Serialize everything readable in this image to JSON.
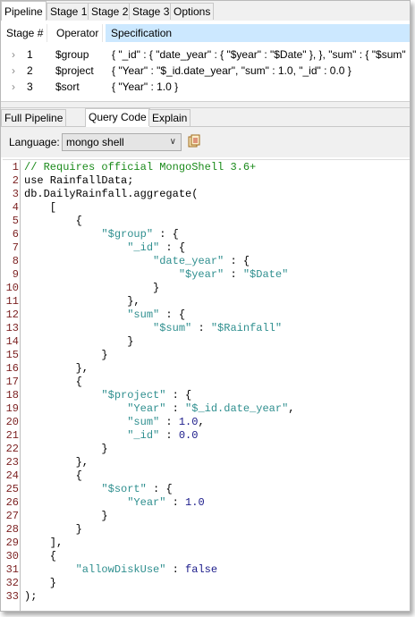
{
  "top_tabs": [
    "Pipeline",
    "Stage 1",
    "Stage 2",
    "Stage 3",
    "Options"
  ],
  "table": {
    "headers": [
      "Stage #",
      "Operator",
      "Specification"
    ],
    "rows": [
      {
        "num": "1",
        "op": "$group",
        "spec": "{ \"_id\" : { \"date_year\" : { \"$year\" : \"$Date\" }, }, \"sum\" : { \"$sum\" :"
      },
      {
        "num": "2",
        "op": "$project",
        "spec": "{ \"Year\" : \"$_id.date_year\", \"sum\" : 1.0, \"_id\" : 0.0 }"
      },
      {
        "num": "3",
        "op": "$sort",
        "spec": "{ \"Year\" : 1.0 }"
      }
    ]
  },
  "bottom_tabs": [
    "Full Pipeline",
    "Query Code",
    "Explain"
  ],
  "language": {
    "label": "Language:",
    "value": "mongo shell"
  },
  "code": {
    "numbers": [
      "1",
      "2",
      "3",
      "4",
      "5",
      "6",
      "7",
      "8",
      "9",
      "10",
      "11",
      "12",
      "13",
      "14",
      "15",
      "16",
      "17",
      "18",
      "19",
      "20",
      "21",
      "22",
      "23",
      "24",
      "25",
      "26",
      "27",
      "28",
      "29",
      "30",
      "31",
      "32",
      "33"
    ],
    "lines": [
      [
        {
          "t": "// Requires official MongoShell 3.6+",
          "c": "c"
        }
      ],
      [
        {
          "t": "use RainfallData;",
          "c": "k"
        }
      ],
      [
        {
          "t": "db.DailyRainfall.aggregate(",
          "c": "k"
        }
      ],
      [
        {
          "t": "    [",
          "c": "k"
        }
      ],
      [
        {
          "t": "        {",
          "c": "k"
        }
      ],
      [
        {
          "t": "            ",
          "c": "k"
        },
        {
          "t": "\"$group\"",
          "c": "s"
        },
        {
          "t": " : {",
          "c": "k"
        }
      ],
      [
        {
          "t": "                ",
          "c": "k"
        },
        {
          "t": "\"_id\"",
          "c": "s"
        },
        {
          "t": " : {",
          "c": "k"
        }
      ],
      [
        {
          "t": "                    ",
          "c": "k"
        },
        {
          "t": "\"date_year\"",
          "c": "s"
        },
        {
          "t": " : {",
          "c": "k"
        }
      ],
      [
        {
          "t": "                        ",
          "c": "k"
        },
        {
          "t": "\"$year\"",
          "c": "s"
        },
        {
          "t": " : ",
          "c": "k"
        },
        {
          "t": "\"$Date\"",
          "c": "s"
        }
      ],
      [
        {
          "t": "                    }",
          "c": "k"
        }
      ],
      [
        {
          "t": "                },",
          "c": "k"
        }
      ],
      [
        {
          "t": "                ",
          "c": "k"
        },
        {
          "t": "\"sum\"",
          "c": "s"
        },
        {
          "t": " : {",
          "c": "k"
        }
      ],
      [
        {
          "t": "                    ",
          "c": "k"
        },
        {
          "t": "\"$sum\"",
          "c": "s"
        },
        {
          "t": " : ",
          "c": "k"
        },
        {
          "t": "\"$Rainfall\"",
          "c": "s"
        }
      ],
      [
        {
          "t": "                }",
          "c": "k"
        }
      ],
      [
        {
          "t": "            }",
          "c": "k"
        }
      ],
      [
        {
          "t": "        },",
          "c": "k"
        }
      ],
      [
        {
          "t": "        {",
          "c": "k"
        }
      ],
      [
        {
          "t": "            ",
          "c": "k"
        },
        {
          "t": "\"$project\"",
          "c": "s"
        },
        {
          "t": " : {",
          "c": "k"
        }
      ],
      [
        {
          "t": "                ",
          "c": "k"
        },
        {
          "t": "\"Year\"",
          "c": "s"
        },
        {
          "t": " : ",
          "c": "k"
        },
        {
          "t": "\"$_id.date_year\"",
          "c": "s"
        },
        {
          "t": ",",
          "c": "k"
        }
      ],
      [
        {
          "t": "                ",
          "c": "k"
        },
        {
          "t": "\"sum\"",
          "c": "s"
        },
        {
          "t": " : ",
          "c": "k"
        },
        {
          "t": "1.0",
          "c": "n"
        },
        {
          "t": ",",
          "c": "k"
        }
      ],
      [
        {
          "t": "                ",
          "c": "k"
        },
        {
          "t": "\"_id\"",
          "c": "s"
        },
        {
          "t": " : ",
          "c": "k"
        },
        {
          "t": "0.0",
          "c": "n"
        }
      ],
      [
        {
          "t": "            }",
          "c": "k"
        }
      ],
      [
        {
          "t": "        },",
          "c": "k"
        }
      ],
      [
        {
          "t": "        {",
          "c": "k"
        }
      ],
      [
        {
          "t": "            ",
          "c": "k"
        },
        {
          "t": "\"$sort\"",
          "c": "s"
        },
        {
          "t": " : {",
          "c": "k"
        }
      ],
      [
        {
          "t": "                ",
          "c": "k"
        },
        {
          "t": "\"Year\"",
          "c": "s"
        },
        {
          "t": " : ",
          "c": "k"
        },
        {
          "t": "1.0",
          "c": "n"
        }
      ],
      [
        {
          "t": "            }",
          "c": "k"
        }
      ],
      [
        {
          "t": "        }",
          "c": "k"
        }
      ],
      [
        {
          "t": "    ],",
          "c": "k"
        }
      ],
      [
        {
          "t": "    {",
          "c": "k"
        }
      ],
      [
        {
          "t": "        ",
          "c": "k"
        },
        {
          "t": "\"allowDiskUse\"",
          "c": "s"
        },
        {
          "t": " : ",
          "c": "k"
        },
        {
          "t": "false",
          "c": "n"
        }
      ],
      [
        {
          "t": "    }",
          "c": "k"
        }
      ],
      [
        {
          "t": ");",
          "c": "k"
        }
      ]
    ]
  }
}
